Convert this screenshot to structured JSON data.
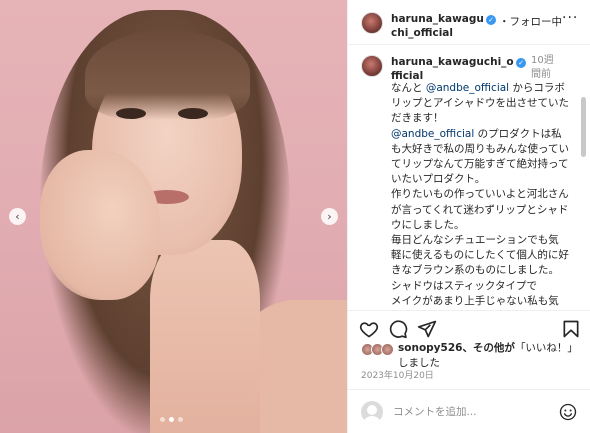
{
  "photo": {
    "prev_icon": "‹",
    "next_icon": "›",
    "slide_count": 3,
    "active_slide": 2
  },
  "header": {
    "username": "haruna_kawaguchi_official",
    "verified_icon": "✓",
    "follow_status": "・フォロー中",
    "more_icon": "···"
  },
  "caption": {
    "username": "haruna_kawaguchi_official",
    "time": "10週間前",
    "line1_pre": "なんと ",
    "line1_mention": "@andbe_official",
    "line1_post": " からコラボリップとアイシャドウを出させていただきます！",
    "line2_mention": "@andbe_official",
    "line2_post": " のプロダクトは私も大好きで私の周りもみんな使っていてリップなんて万能すぎて絶対持っていたいプロダクト。",
    "line3": "作りたいもの作っていいよと河北さんが言ってくれて迷わずリップとシャドウにしました。",
    "line4": "毎日どんなシチュエーションでも気軽に使えるものにしたくて個人的に好きなブラウン系のものにしました。",
    "line5": "シャドウはスティックタイプで",
    "line6": "メイクがあまり上手じゃない私も気軽に使えて本当にありがたい。笑"
  },
  "actions": {
    "like_icon": "heart-icon",
    "comment_icon": "comment-icon",
    "share_icon": "share-icon",
    "save_icon": "bookmark-icon"
  },
  "likes": {
    "user": "sonopy526",
    "text_mid": "、その他が",
    "like_word": "「いいね！」",
    "text_end": "しました"
  },
  "date": "2023年10月20日",
  "comment": {
    "placeholder": "コメントを追加..."
  },
  "colors": {
    "verified": "#3897f0",
    "mention": "#00376b",
    "background_photo": "#e2aeb3"
  }
}
